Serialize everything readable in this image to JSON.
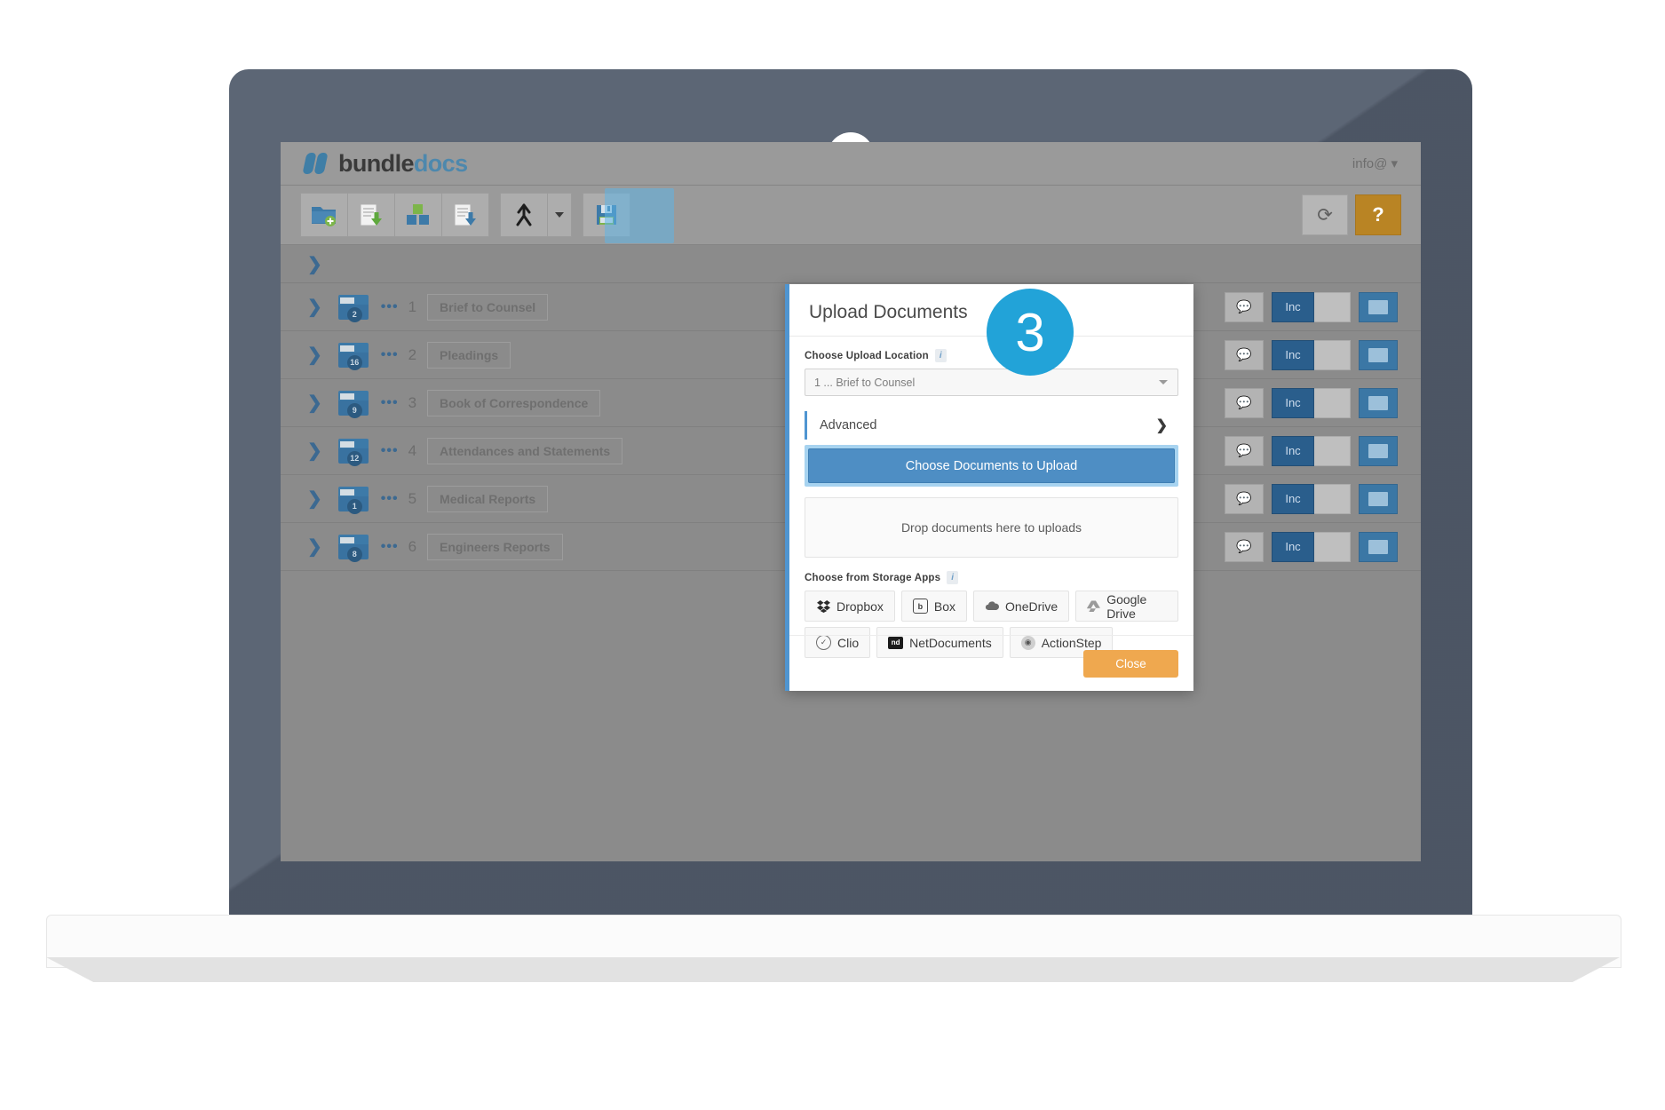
{
  "app": {
    "brand": {
      "part1": "bundle",
      "part2": "docs",
      "icon": "bundledocs-logo-icon"
    },
    "user_menu": "info@ ▾",
    "toolbar": {
      "buttons": [
        {
          "name": "new-folder-button",
          "icon": "folder-add-icon"
        },
        {
          "name": "upload-documents-button",
          "icon": "document-upload-icon",
          "highlighted": true
        },
        {
          "name": "add-section-button",
          "icon": "blocks-icon"
        },
        {
          "name": "download-documents-button",
          "icon": "document-download-icon"
        },
        {
          "name": "merge-button",
          "icon": "merge-arrows-icon"
        },
        {
          "name": "merge-dropdown-button",
          "icon": "chevron-down-icon"
        },
        {
          "name": "save-button",
          "icon": "floppy-disk-save-icon"
        }
      ],
      "refresh_icon": "⟳",
      "help_icon": "?"
    },
    "folders": [
      {
        "badge": "2",
        "dots": "•••",
        "number": "1",
        "label": "Brief to Counsel",
        "inc": "Inc"
      },
      {
        "badge": "16",
        "dots": "•••",
        "number": "2",
        "label": "Pleadings",
        "inc": "Inc"
      },
      {
        "badge": "9",
        "dots": "•••",
        "number": "3",
        "label": "Book of Correspondence",
        "inc": "Inc"
      },
      {
        "badge": "12",
        "dots": "•••",
        "number": "4",
        "label": "Attendances and Statements",
        "inc": "Inc"
      },
      {
        "badge": "1",
        "dots": "•••",
        "number": "5",
        "label": "Medical Reports",
        "inc": "Inc"
      },
      {
        "badge": "8",
        "dots": "•••",
        "number": "6",
        "label": "Engineers Reports",
        "inc": "Inc"
      }
    ]
  },
  "modal": {
    "title": "Upload Documents",
    "upload_location": {
      "label": "Choose Upload Location",
      "info_glyph": "i",
      "value": "1 ... Brief to Counsel"
    },
    "advanced": {
      "label": "Advanced",
      "arrow": "❯"
    },
    "choose_button": "Choose Documents to Upload",
    "dropzone_text": "Drop documents here to uploads",
    "storage": {
      "label": "Choose from Storage Apps",
      "info_glyph": "i",
      "row1": [
        {
          "name": "dropbox-button",
          "label": "Dropbox",
          "icon": "dropbox-icon",
          "glyph": "✤"
        },
        {
          "name": "box-button",
          "label": "Box",
          "icon": "box-icon",
          "glyph": "b"
        },
        {
          "name": "onedrive-button",
          "label": "OneDrive",
          "icon": "onedrive-cloud-icon",
          "glyph": "☁"
        },
        {
          "name": "google-drive-button",
          "label": "Google Drive",
          "icon": "google-drive-icon",
          "glyph": "◭"
        }
      ],
      "row2": [
        {
          "name": "clio-button",
          "label": "Clio",
          "icon": "clio-icon",
          "glyph": "✓"
        },
        {
          "name": "netdocuments-button",
          "label": "NetDocuments",
          "icon": "netdocuments-icon",
          "glyph": "nd"
        },
        {
          "name": "actionstep-button",
          "label": "ActionStep",
          "icon": "actionstep-icon",
          "glyph": "◉"
        }
      ]
    },
    "close_button": "Close"
  },
  "annotation": {
    "step_number": "3"
  },
  "colors": {
    "accent_blue": "#4f95d1",
    "step_bubble": "#22a3d8",
    "close_orange": "#efa84f",
    "brand_blue": "#4d88ad",
    "highlight_blue": "#a7d3f0"
  }
}
